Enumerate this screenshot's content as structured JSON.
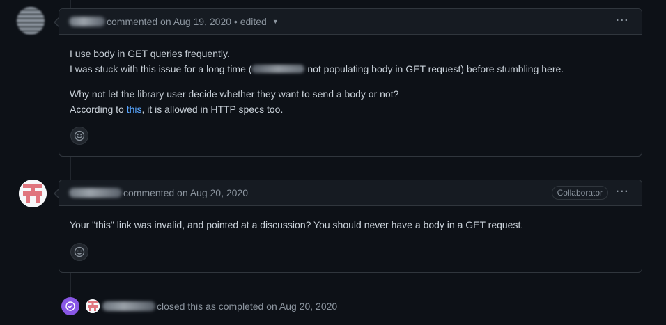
{
  "comment1": {
    "meta": "commented on Aug 19, 2020 • edited",
    "line1": "I use body in GET queries frequently.",
    "line2_before": "I was stuck with this issue for a long time (",
    "line2_after": " not populating body in GET request) before stumbling here.",
    "line3": "Why not let the library user decide whether they want to send a body or not?",
    "line4_before": "According to ",
    "line4_link": "this",
    "line4_after": ", it is allowed in HTTP specs too."
  },
  "comment2": {
    "meta": "commented on Aug 20, 2020",
    "badge": "Collaborator",
    "body": "Your \"this\" link was invalid, and pointed at a discussion? You should never have a body in a GET request."
  },
  "event": {
    "text": "closed this as completed on Aug 20, 2020"
  },
  "icons": [
    "kebab-menu-icon",
    "caret-down-icon",
    "smiley-icon",
    "check-circle-icon"
  ],
  "colors": {
    "link": "#58a6ff",
    "closed_badge": "#8957e5",
    "identicon": "#e0757e"
  }
}
